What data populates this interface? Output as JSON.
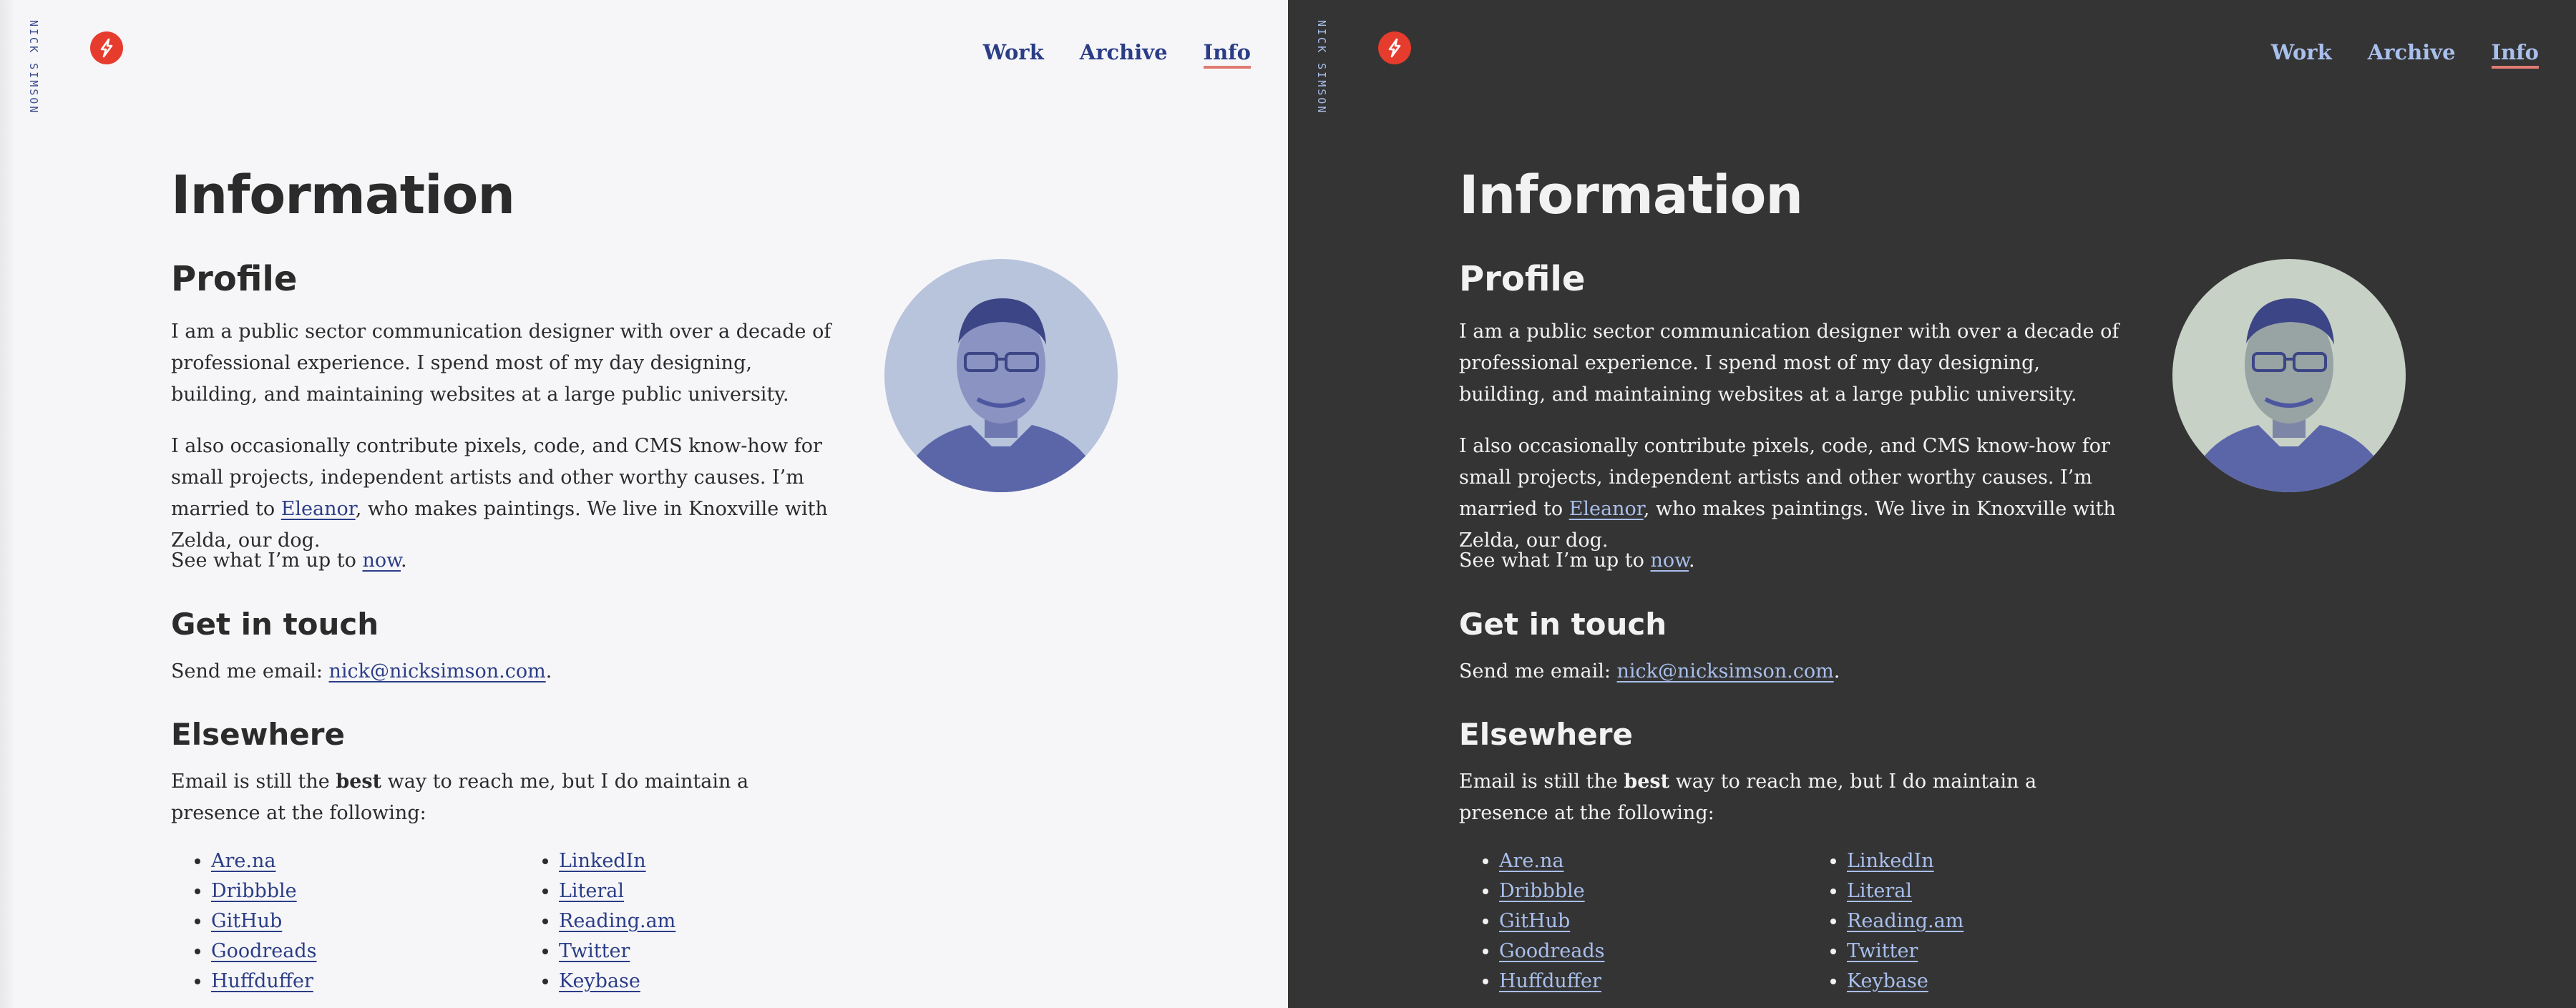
{
  "site": {
    "vertical_name": "NICK SIMSON"
  },
  "nav": [
    {
      "label": "Work",
      "active": false
    },
    {
      "label": "Archive",
      "active": false
    },
    {
      "label": "Info",
      "active": true
    }
  ],
  "page": {
    "title": "Information",
    "profile": {
      "heading": "Profile",
      "p1": "I am a public sector communication designer with over a decade of professional experience. I spend most of my day designing, building, and maintaining websites at a large public university.",
      "p2_before": "I also occasionally contribute pixels, code, and CMS know-how for small projects, independent artists and other worthy causes. I’m married to ",
      "p2_link": "Eleanor",
      "p2_after": ", who makes paintings. We live in Knoxville with Zelda, our dog.",
      "p3_before": "See what I’m up to ",
      "p3_link": "now",
      "p3_after": "."
    },
    "contact": {
      "heading": "Get in touch",
      "before": "Send me email: ",
      "email": "nick@nicksimson.com",
      "after": "."
    },
    "elsewhere": {
      "heading": "Elsewhere",
      "before": "Email is still the ",
      "bold": "best",
      "after": " way to reach me, but I do maintain a presence at the following:",
      "col1": [
        "Are.na",
        "Dribbble",
        "GitHub",
        "Goodreads",
        "Huffduffer"
      ],
      "col2": [
        "LinkedIn",
        "Literal",
        "Reading.am",
        "Twitter",
        "Keybase"
      ]
    }
  },
  "colors": {
    "light_bg": "#f6f6f9",
    "dark_bg": "#343434",
    "accent_red": "#e63c2e",
    "link_light": "#2b3d86",
    "link_dark": "#a9bfec"
  },
  "icons": {
    "logo": "lightning-logo-icon",
    "avatar": "portrait-photo"
  }
}
